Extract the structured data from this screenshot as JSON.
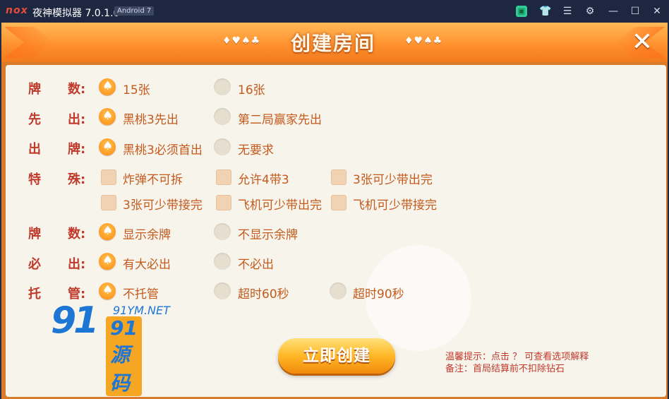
{
  "titlebar": {
    "logo": "nox",
    "title": "夜神模拟器 7.0.1.0",
    "android": "Android 7",
    "icons": [
      "store-icon",
      "shirt-icon",
      "menu-icon",
      "gear-icon",
      "minimize-icon",
      "maximize-icon",
      "close-icon"
    ]
  },
  "dialog": {
    "title": "创建房间",
    "suits": "♦♥♠♣",
    "rows": [
      {
        "label": [
          "牌",
          "数:"
        ],
        "options": [
          {
            "text": "15张",
            "type": "radio",
            "selected": true
          },
          {
            "text": "16张",
            "type": "radio",
            "selected": false
          }
        ]
      },
      {
        "label": [
          "先",
          "出:"
        ],
        "options": [
          {
            "text": "黑桃3先出",
            "type": "radio",
            "selected": true
          },
          {
            "text": "第二局赢家先出",
            "type": "radio",
            "selected": false
          }
        ]
      },
      {
        "label": [
          "出",
          "牌:"
        ],
        "options": [
          {
            "text": "黑桃3必须首出",
            "type": "radio",
            "selected": true
          },
          {
            "text": "无要求",
            "type": "radio",
            "selected": false
          }
        ]
      },
      {
        "label": [
          "特",
          "殊:"
        ],
        "options": [
          {
            "text": "炸弹不可拆",
            "type": "check"
          },
          {
            "text": "允许4带3",
            "type": "check"
          },
          {
            "text": "3张可少带出完",
            "type": "check"
          },
          {
            "text": "3张可少带接完",
            "type": "check"
          },
          {
            "text": "飞机可少带出完",
            "type": "check"
          },
          {
            "text": "飞机可少带接完",
            "type": "check"
          }
        ]
      },
      {
        "label": [
          "牌",
          "数:"
        ],
        "options": [
          {
            "text": "显示余牌",
            "type": "radio",
            "selected": true
          },
          {
            "text": "不显示余牌",
            "type": "radio",
            "selected": false
          }
        ]
      },
      {
        "label": [
          "必",
          "出:"
        ],
        "options": [
          {
            "text": "有大必出",
            "type": "radio",
            "selected": true
          },
          {
            "text": "不必出",
            "type": "radio",
            "selected": false
          }
        ]
      },
      {
        "label": [
          "托",
          "管:"
        ],
        "options": [
          {
            "text": "不托管",
            "type": "radio",
            "selected": true
          },
          {
            "text": "超时60秒",
            "type": "radio",
            "selected": false
          },
          {
            "text": "超时90秒",
            "type": "radio",
            "selected": false
          }
        ]
      }
    ],
    "create_button": "立即创建",
    "tip_line1": "温馨提示：点击 ？ 可查看选项解释",
    "tip_line2": "备注：首局结算前不扣除钻石"
  },
  "watermark": {
    "big": "91",
    "url": "91YM.NET",
    "cn": "91源码"
  },
  "colors": {
    "accent": "#ff9a1f",
    "label": "#c0392b",
    "option": "#c45a1d"
  }
}
